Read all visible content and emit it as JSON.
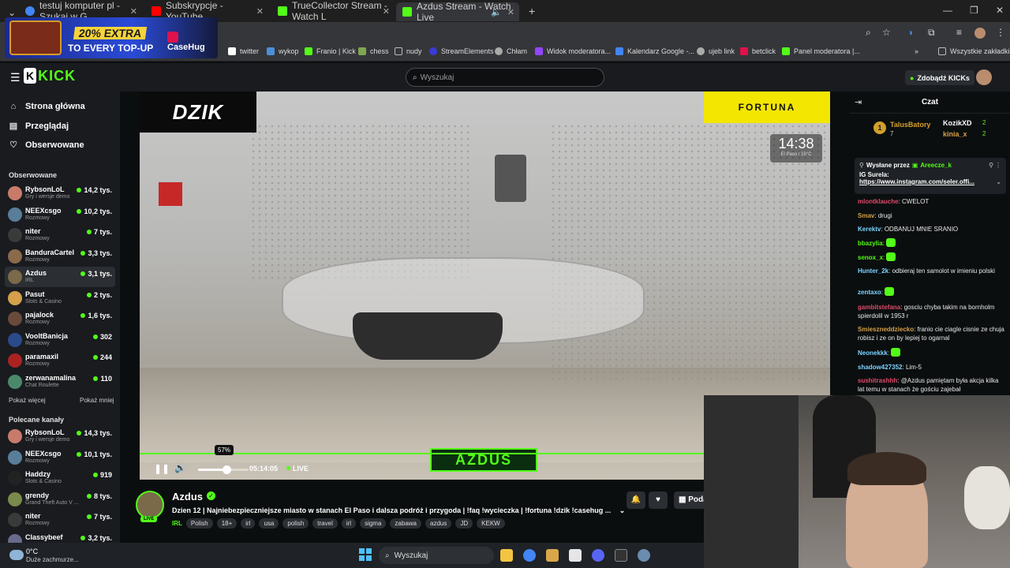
{
  "browser": {
    "tabs": [
      {
        "title": "testuj komputer pl - Szukaj w G",
        "color": "#4285f4"
      },
      {
        "title": "Subskrypcje - YouTube",
        "color": "#ff0000"
      },
      {
        "title": "TrueCollector Stream - Watch L",
        "color": "#53fc18"
      },
      {
        "title": "Azdus Stream - Watch Live",
        "color": "#53fc18"
      }
    ],
    "bookmarks": [
      {
        "label": "twitter",
        "color": "#ffffff"
      },
      {
        "label": "wykop",
        "color": "#4a90d9"
      },
      {
        "label": "Franio | Kick",
        "color": "#53fc18"
      },
      {
        "label": "chess",
        "color": "#7fa650"
      },
      {
        "label": "nudy",
        "color": "#aaaaaa"
      },
      {
        "label": "StreamElements",
        "color": "#3b3bd6"
      },
      {
        "label": "Chłam",
        "color": "#aaaaaa"
      },
      {
        "label": "Widok moderatora...",
        "color": "#9146ff"
      },
      {
        "label": "Kalendarz Google -...",
        "color": "#4285f4"
      },
      {
        "label": "ujeb link",
        "color": "#aaaaaa"
      },
      {
        "label": "betclick",
        "color": "#e0124b"
      },
      {
        "label": "Panel moderatora |...",
        "color": "#53fc18"
      }
    ],
    "all_bookmarks": "Wszystkie zakładki"
  },
  "ad": {
    "line1": "20% EXTRA",
    "line2": "TO EVERY TOP-UP",
    "brand": "CaseHug"
  },
  "header": {
    "logo": "KICK",
    "search_placeholder": "Wyszukaj",
    "kicks_button": "Zdobądź KICKs"
  },
  "sidebar": {
    "nav": [
      {
        "label": "Strona główna",
        "icon": "⌂"
      },
      {
        "label": "Przeglądaj",
        "icon": "▤"
      },
      {
        "label": "Obserwowane",
        "icon": "♡"
      }
    ],
    "followed_title": "Obserwowane",
    "followed": [
      {
        "name": "RybsonLoL",
        "category": "Gry i wersje demo",
        "viewers": "14,2 tys.",
        "color": "#c97b6b"
      },
      {
        "name": "NEEXcsgo",
        "category": "Rozmowy",
        "viewers": "10,2 tys.",
        "color": "#5a7d9a"
      },
      {
        "name": "niter",
        "category": "Rozmowy",
        "viewers": "7 tys.",
        "color": "#3a3a3a"
      },
      {
        "name": "BanduraCartel",
        "category": "Rozmowy",
        "viewers": "3,3 tys.",
        "color": "#8a6a4a"
      },
      {
        "name": "Azdus",
        "category": "IRL",
        "viewers": "3,1 tys.",
        "color": "#7a6a4a"
      },
      {
        "name": "Pasut",
        "category": "Slots & Casino",
        "viewers": "2 tys.",
        "color": "#d4a04a"
      },
      {
        "name": "pajalock",
        "category": "Rozmowy",
        "viewers": "1,6 tys.",
        "color": "#6a4a3a"
      },
      {
        "name": "VooltBanicja",
        "category": "Rozmowy",
        "viewers": "302",
        "color": "#2a4a8a"
      },
      {
        "name": "paramaxil",
        "category": "Rozmowy",
        "viewers": "244",
        "color": "#aa2222"
      },
      {
        "name": "zerwanamalina",
        "category": "Chat Roulette",
        "viewers": "110",
        "color": "#4a8a6a"
      }
    ],
    "show_more": "Pokaż więcej",
    "show_less": "Pokaż mniej",
    "recommended_title": "Polecane kanały",
    "recommended": [
      {
        "name": "RybsonLoL",
        "category": "Gry i wersje demo",
        "viewers": "14,3 tys.",
        "color": "#c97b6b"
      },
      {
        "name": "NEEXcsgo",
        "category": "Rozmowy",
        "viewers": "10,1 tys.",
        "color": "#5a7d9a"
      },
      {
        "name": "Haddzy",
        "category": "Slots & Casino",
        "viewers": "919",
        "color": "#222222"
      },
      {
        "name": "grendy",
        "category": "Grand Theft Auto V ...",
        "viewers": "8 tys.",
        "color": "#7a8a4a"
      },
      {
        "name": "niter",
        "category": "Rozmowy",
        "viewers": "7 tys.",
        "color": "#3a3a3a"
      },
      {
        "name": "Classybeef",
        "category": "",
        "viewers": "3,2 tys.",
        "color": "#6a6a8a"
      }
    ]
  },
  "video": {
    "overlay_left": "DZIK",
    "overlay_right": "FORTUNA",
    "clock": "14:38",
    "weather": "El Paso / 15°C",
    "watermark": "AZDUS",
    "volume_tooltip": "57%",
    "volume_level": 0.57,
    "elapsed": "05:14:05",
    "live_label": "LIVE"
  },
  "stream": {
    "name": "Azdus",
    "live_badge": "LIVE",
    "title": "Dzien 12 | Najniebezpieczniejsze miasto w stanach El Paso i dalsza podróż i przygoda | !faq !wycieczka | !fortuna !dzik !casehug ...",
    "category": "IRL",
    "tags": [
      "Polish",
      "18+",
      "irl",
      "usa",
      "polish",
      "travel",
      "irl",
      "sigma",
      "zabawa",
      "azdus",
      "JD",
      "KEKW"
    ],
    "share_label": "Poda"
  },
  "chat": {
    "title": "Czat",
    "top_gifter": {
      "rank": "1",
      "name": "TalusBatory",
      "count": "7"
    },
    "gifters": [
      {
        "name": "KozikXD",
        "count": "2"
      },
      {
        "name": "kinia_x",
        "count": "2"
      }
    ],
    "pinned": {
      "sent_by": "Wysłane przez",
      "author": "Areecze_k",
      "text": "IG Surela:",
      "link": "https://www.instagram.com/seler.offi..."
    },
    "messages": [
      {
        "user": "mlontklauche",
        "text": "CWELOT",
        "color": "#e04a6a"
      },
      {
        "user": "Smav",
        "text": "drugi",
        "color": "#d4a04a"
      },
      {
        "user": "Kerektv",
        "text": "ODBANUJ MNIE SRANIO",
        "color": "#7ad4ff"
      },
      {
        "user": "bbazylia",
        "text": "",
        "color": "#53fc18"
      },
      {
        "user": "senox_x",
        "text": "",
        "color": "#53fc18"
      },
      {
        "user": "Hunter_2k",
        "text": "odbieraj ten samolot w imieniu polski",
        "color": "#7ad4ff"
      },
      {
        "user": "zentaxo",
        "text": "",
        "color": "#7ad4ff"
      },
      {
        "user": "gambitstefana",
        "text": "gosciu chyba takim na bornholm spierdolil w 1953 r",
        "color": "#e04a6a"
      },
      {
        "user": "Smieszneddziecko",
        "text": "franio cie ciagle cisnie ze chuja robisz i ze on by lepiej to ogarnal",
        "color": "#d4a04a"
      },
      {
        "user": "Neonekkk",
        "text": "",
        "color": "#7ad4ff"
      },
      {
        "user": "shadow427352",
        "text": "Lim-5",
        "color": "#7ad4ff"
      },
      {
        "user": "sushitrashhh",
        "text": "@Azdus pamiętam była akcja kilka lat temu w stanach że gościu zajebał",
        "color": "#e04a6a"
      }
    ]
  },
  "taskbar": {
    "weather_temp": "0°C",
    "weather_desc": "Duże zachmurze...",
    "search_placeholder": "Wyszukaj"
  }
}
